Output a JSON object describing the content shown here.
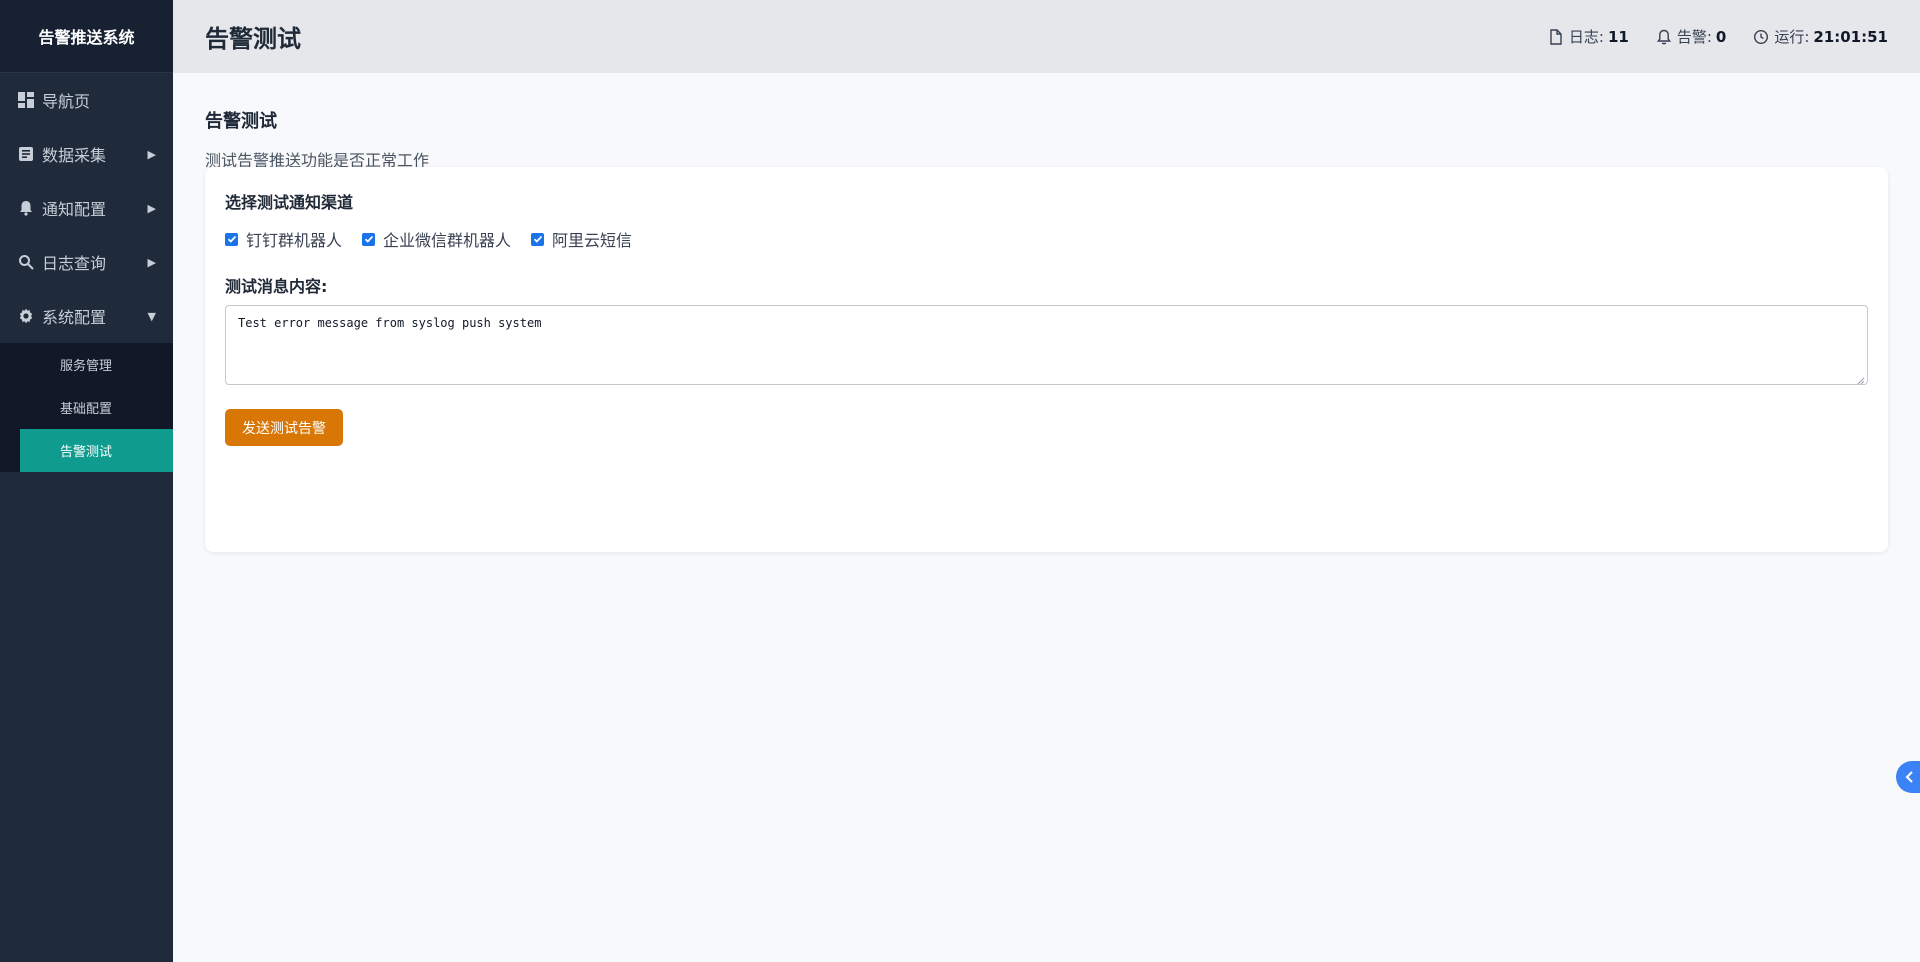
{
  "app": {
    "brand": "告警推送系统"
  },
  "header": {
    "title": "告警测试",
    "stats": {
      "logs_label": "日志:",
      "logs_value": "11",
      "alerts_label": "告警:",
      "alerts_value": "0",
      "uptime_label": "运行:",
      "uptime_value": "21:01:51"
    }
  },
  "sidebar": {
    "items": [
      {
        "label": "导航页",
        "icon": "dashboard-icon"
      },
      {
        "label": "数据采集",
        "icon": "document-icon"
      },
      {
        "label": "通知配置",
        "icon": "bell-icon"
      },
      {
        "label": "日志查询",
        "icon": "search-icon"
      },
      {
        "label": "系统配置",
        "icon": "gear-icon"
      }
    ],
    "sub_items": [
      {
        "label": "服务管理"
      },
      {
        "label": "基础配置"
      },
      {
        "label": "告警测试",
        "active": true
      }
    ]
  },
  "main": {
    "section_title": "告警测试",
    "section_desc": "测试告警推送功能是否正常工作",
    "card": {
      "channels_title": "选择测试通知渠道",
      "channels": [
        {
          "label": "钉钉群机器人",
          "checked": true
        },
        {
          "label": "企业微信群机器人",
          "checked": true
        },
        {
          "label": "阿里云短信",
          "checked": true
        }
      ],
      "message_label": "测试消息内容:",
      "message_value": "Test error message from syslog push system",
      "send_button": "发送测试告警"
    }
  },
  "colors": {
    "sidebar_bg": "#1f2a3a",
    "active_item": "#0f9b8e",
    "send_button": "#d97706",
    "checkbox": "#1a73e8"
  }
}
